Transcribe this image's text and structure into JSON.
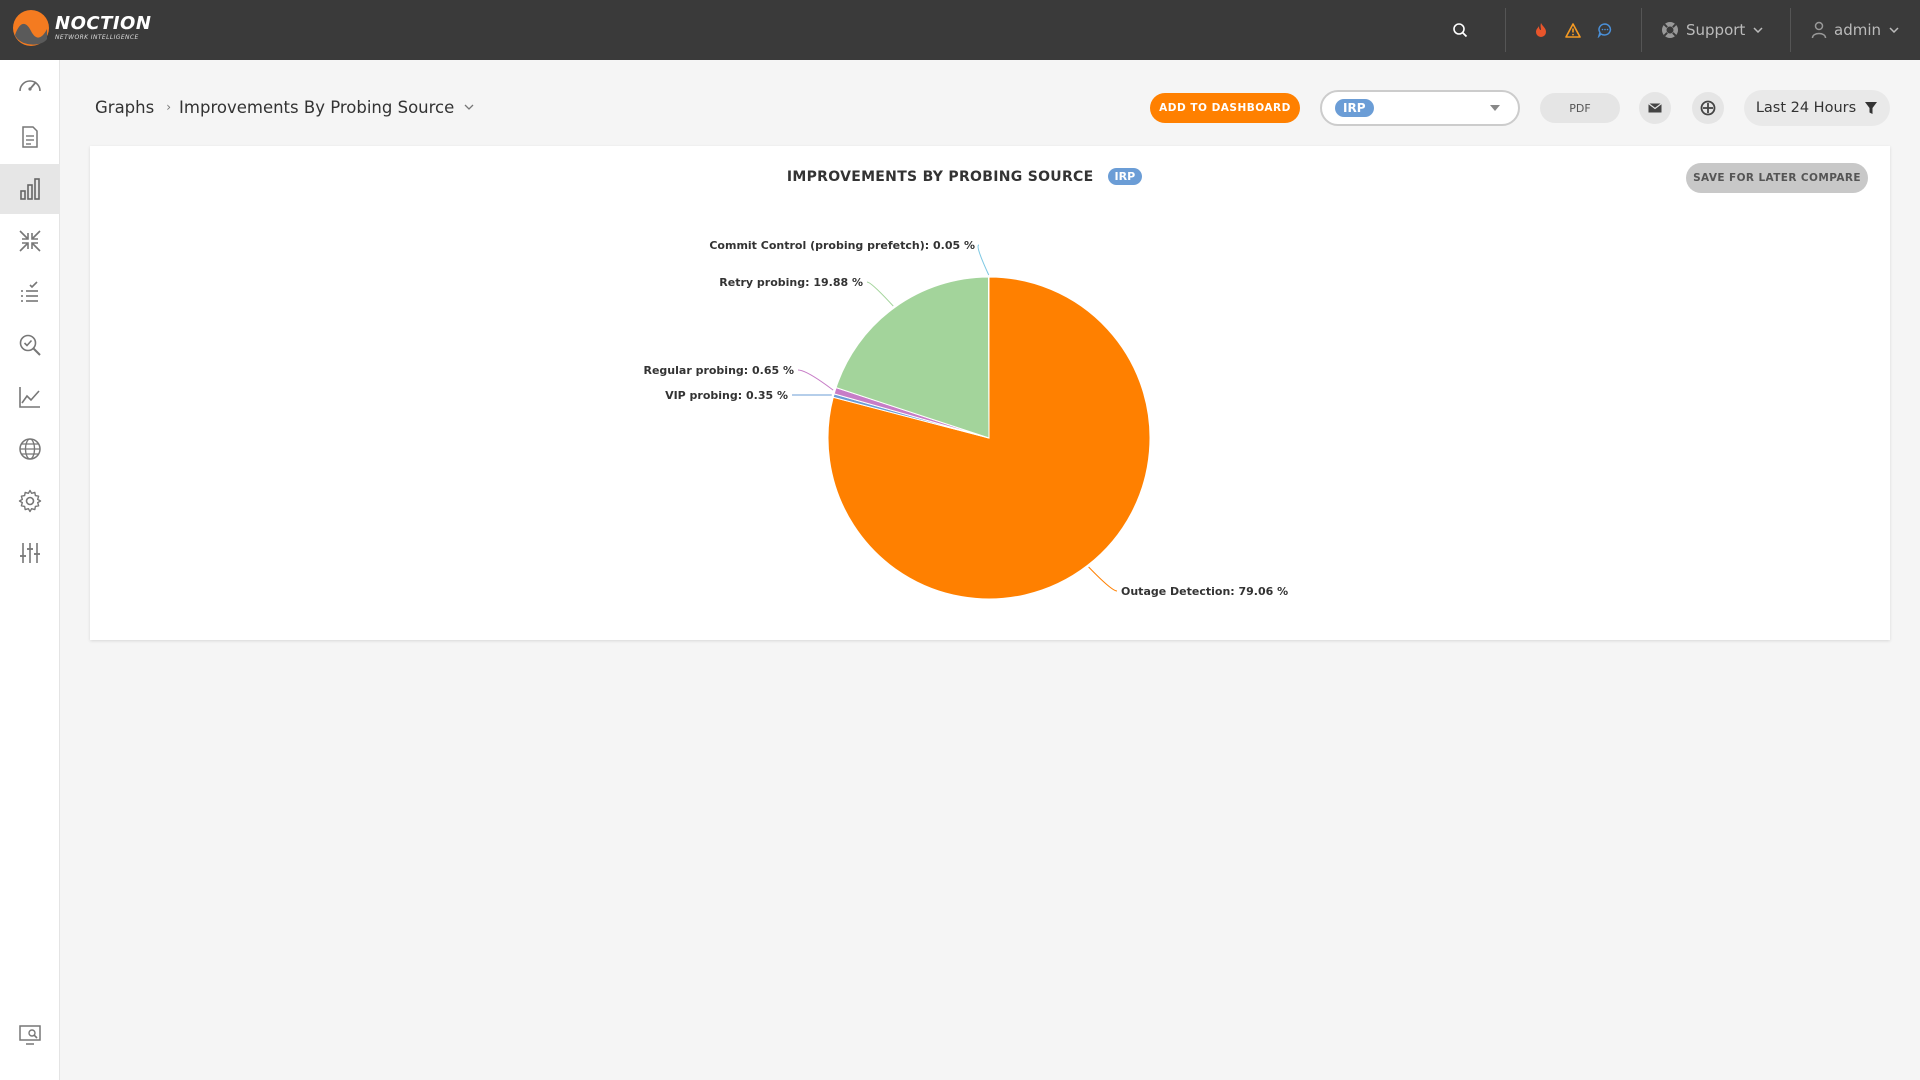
{
  "brand": {
    "name": "NOCTION",
    "tagline": "NETWORK INTELLIGENCE"
  },
  "topbar": {
    "support_label": "Support",
    "user_label": "admin",
    "colors": {
      "alert_fire": "#e8552b",
      "alert_warning": "#f59a23",
      "chat": "#4a90d9"
    }
  },
  "sidebar": {
    "items": [
      {
        "icon": "speedometer-icon"
      },
      {
        "icon": "report-icon"
      },
      {
        "icon": "bar-chart-icon",
        "active": true
      },
      {
        "icon": "collapse-arrows-icon"
      },
      {
        "icon": "checklist-icon"
      },
      {
        "icon": "search-check-icon"
      },
      {
        "icon": "line-chart-icon"
      },
      {
        "icon": "globe-icon"
      },
      {
        "icon": "gear-icon"
      },
      {
        "icon": "sliders-icon"
      }
    ],
    "bottom_icon": "monitor-search-icon"
  },
  "header": {
    "breadcrumb_root": "Graphs",
    "breadcrumb_current": "Improvements By Probing Source",
    "add_to_dashboard": "ADD TO DASHBOARD",
    "select_value": "IRP",
    "pdf_label": "PDF",
    "time_range": "Last 24 Hours"
  },
  "card": {
    "title": "IMPROVEMENTS BY PROBING SOURCE",
    "tag": "IRP",
    "save_button": "SAVE FOR LATER COMPARE"
  },
  "chart_data": {
    "type": "pie",
    "title": "IMPROVEMENTS BY PROBING SOURCE",
    "unit": "%",
    "slices": [
      {
        "name": "Outage Detection",
        "value": 79.06,
        "color": "#ff8000",
        "label": "Outage Detection: 79.06 %"
      },
      {
        "name": "VIP probing",
        "value": 0.35,
        "color": "#6b9dd6",
        "label": "VIP probing: 0.35 %"
      },
      {
        "name": "Regular probing",
        "value": 0.65,
        "color": "#c77dc7",
        "label": "Regular probing: 0.65 %"
      },
      {
        "name": "Retry probing",
        "value": 19.88,
        "color": "#a3d49b",
        "label": "Retry probing: 19.88 %"
      },
      {
        "name": "Commit Control (probing prefetch)",
        "value": 0.05,
        "color": "#7ec8e3",
        "label": "Commit Control (probing prefetch): 0.05 %"
      }
    ]
  }
}
